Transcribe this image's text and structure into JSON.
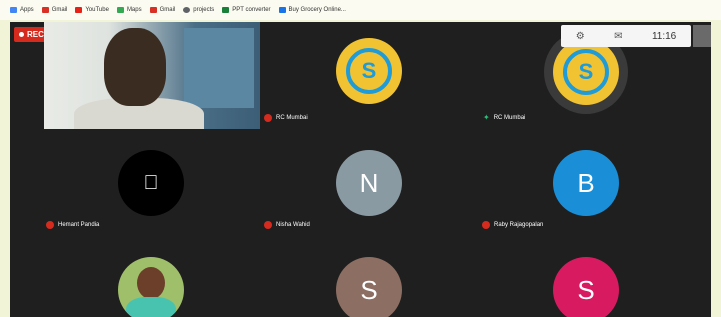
{
  "bookmarks": [
    {
      "label": "Apps",
      "color": "#4285f4"
    },
    {
      "label": "Gmail",
      "color": "#d93025"
    },
    {
      "label": "YouTube",
      "color": "#e62117"
    },
    {
      "label": "Maps",
      "color": "#34a853"
    },
    {
      "label": "Gmail",
      "color": "#d93025"
    },
    {
      "label": "projects",
      "color": "#5f6368"
    },
    {
      "label": "PPT converter",
      "color": "#188038"
    },
    {
      "label": "Buy Grocery Online...",
      "color": "#1a73e8"
    }
  ],
  "meeting": {
    "rec_label": "REC",
    "clock": "11:16",
    "tiles": [
      {
        "name": "",
        "type": "video",
        "mic": "none"
      },
      {
        "name": "RC Mumbai",
        "type": "logo",
        "mic": "muted"
      },
      {
        "name": "RC Mumbai",
        "type": "logo",
        "mic": "active"
      },
      {
        "name": "Hemant Pandia",
        "type": "apple",
        "mic": "muted"
      },
      {
        "name": "Nisha Wahid",
        "type": "initial",
        "initial": "N",
        "color": "#8a9aa3",
        "mic": "muted"
      },
      {
        "name": "Raby Rajagopalan",
        "type": "initial",
        "initial": "B",
        "color": "#1a8fd8",
        "mic": "muted"
      },
      {
        "name": "",
        "type": "photo",
        "mic": "none"
      },
      {
        "name": "",
        "type": "initial",
        "initial": "S",
        "color": "#8d6e63",
        "mic": "none"
      },
      {
        "name": "",
        "type": "initial",
        "initial": "S",
        "color": "#d81b60",
        "mic": "none"
      }
    ]
  }
}
